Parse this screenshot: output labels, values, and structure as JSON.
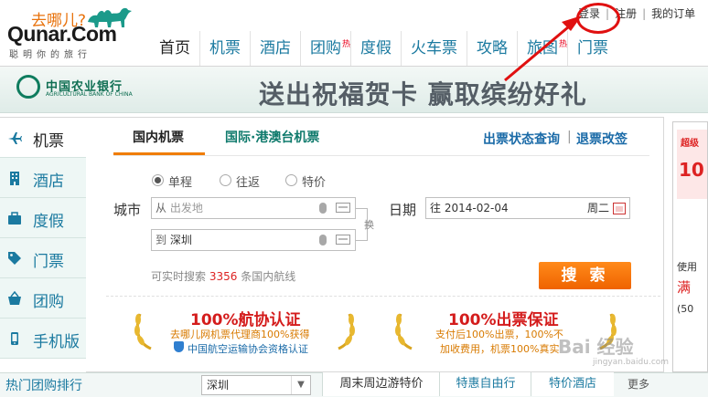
{
  "logo": {
    "slogan": "去哪儿?",
    "name": "Qunar.Com",
    "tagline": "聪明你的旅行"
  },
  "top_links": {
    "login": "登录",
    "register": "注册",
    "separator": "|",
    "my_orders": "我的订单"
  },
  "main_nav": [
    {
      "label": "首页",
      "badge": ""
    },
    {
      "label": "机票",
      "badge": ""
    },
    {
      "label": "酒店",
      "badge": ""
    },
    {
      "label": "团购",
      "badge": "热"
    },
    {
      "label": "度假",
      "badge": ""
    },
    {
      "label": "火车票",
      "badge": ""
    },
    {
      "label": "攻略",
      "badge": ""
    },
    {
      "label": "旅图",
      "badge": "热"
    },
    {
      "label": "门票",
      "badge": ""
    }
  ],
  "banner": {
    "bank_name": "中国农业银行",
    "bank_en": "AGRICULTURAL BANK OF CHINA",
    "slogan": "送出祝福贺卡 赢取缤纷好礼"
  },
  "sidebar": [
    {
      "label": "机票",
      "icon": "plane-icon"
    },
    {
      "label": "酒店",
      "icon": "building-icon"
    },
    {
      "label": "度假",
      "icon": "suitcase-icon"
    },
    {
      "label": "门票",
      "icon": "tag-icon"
    },
    {
      "label": "团购",
      "icon": "basket-icon"
    },
    {
      "label": "手机版",
      "icon": "phone-icon"
    }
  ],
  "search": {
    "tabs": {
      "domestic": "国内机票",
      "international": "国际·港澳台机票"
    },
    "links": {
      "status": "出票状态查询",
      "sep": "|",
      "refund": "退票改签"
    },
    "trip_types": [
      "单程",
      "往返",
      "特价"
    ],
    "selected_trip": "单程",
    "city_label": "城市",
    "from_prefix": "从",
    "from_placeholder": "出发地",
    "to_prefix": "到",
    "to_value": "深圳",
    "swap_label": "换",
    "date_label": "日期",
    "date_prefix": "往",
    "date_value": "2014-02-04",
    "weekday": "周二",
    "hint_prefix": "可实时搜索",
    "route_count": "3356",
    "hint_suffix": "条国内航线",
    "button": "搜 索"
  },
  "guarantees": [
    {
      "title": "100%航协认证",
      "line1": "去哪儿网机票代理商100%获得",
      "line2": "中国航空运输协会资格认证"
    },
    {
      "title": "100%出票保证",
      "line1": "支付后100%出票，100%不",
      "line2": "加收费用，机票100%真实"
    }
  ],
  "right_ad": {
    "t1": "超级",
    "t2": "10",
    "t3": "使用",
    "t4": "满",
    "t5": "(50"
  },
  "bottom": {
    "title": "热门团购排行",
    "city": "深圳",
    "tabs": [
      "周末周边游特价",
      "特惠自由行",
      "特价酒店"
    ],
    "more": "更多"
  },
  "watermark": {
    "text": "Bai 经验",
    "sub": "jingyan.baidu.com"
  },
  "colors": {
    "accent": "#1b7aa0",
    "orange": "#f07d00",
    "annotation": "#e01010",
    "bank_green": "#0e7c5e"
  }
}
